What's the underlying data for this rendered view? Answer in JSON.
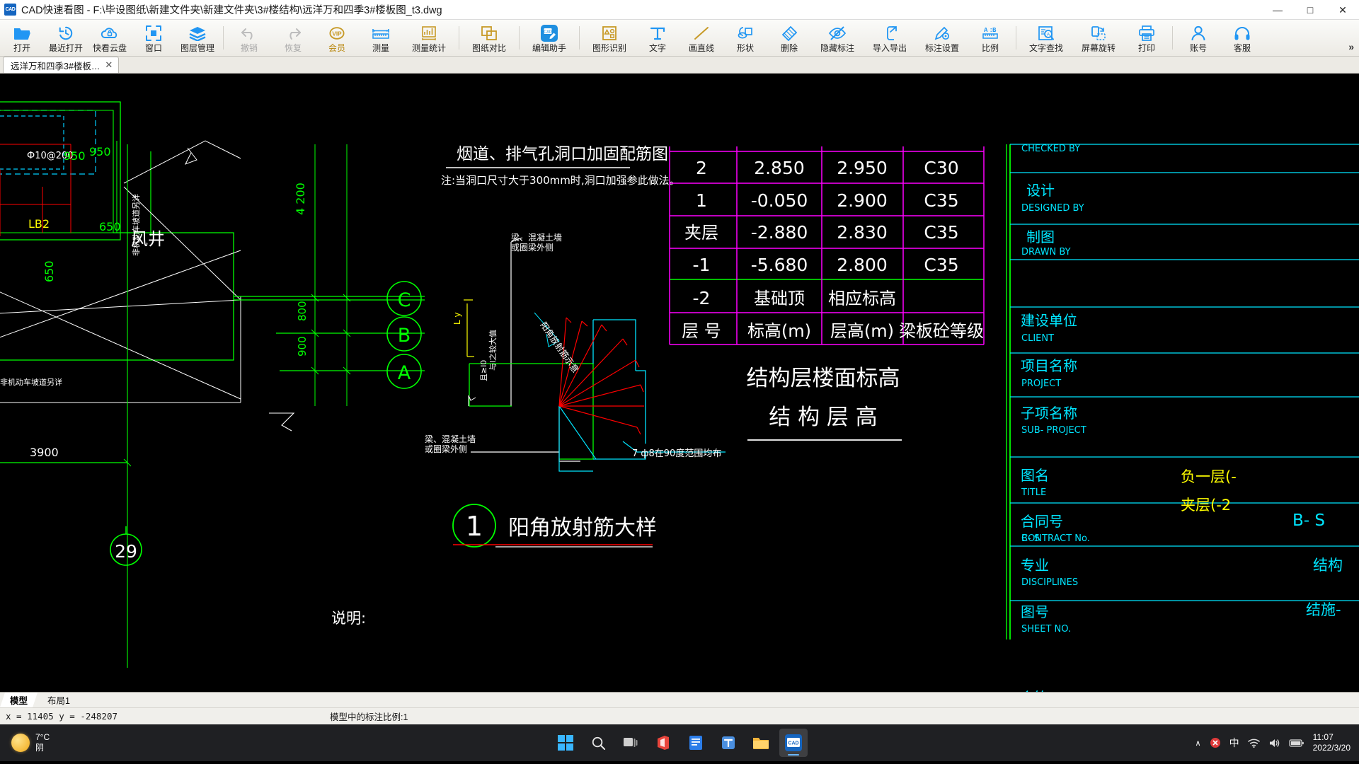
{
  "window": {
    "app_icon": "cad-app-icon",
    "title": "CAD快速看图 - F:\\毕设图纸\\新建文件夹\\新建文件夹\\3#楼结构\\远洋万和四季3#楼板图_t3.dwg",
    "minimize": "—",
    "maximize": "□",
    "close": "✕"
  },
  "toolbar": {
    "overflow": "»",
    "items": [
      {
        "label": "打开",
        "icon": "folder-open-icon",
        "state": "normal"
      },
      {
        "label": "最近打开",
        "icon": "recent-clock-icon",
        "state": "normal"
      },
      {
        "label": "快看云盘",
        "icon": "cloud-icon",
        "state": "normal"
      },
      {
        "label": "窗口",
        "icon": "window-frame-icon",
        "state": "normal"
      },
      {
        "label": "图层管理",
        "icon": "layers-icon",
        "state": "normal"
      },
      {
        "label": "撤销",
        "icon": "undo-arrow-icon",
        "state": "disabled"
      },
      {
        "label": "恢复",
        "icon": "redo-arrow-icon",
        "state": "disabled"
      },
      {
        "label": "会员",
        "icon": "vip-badge-icon",
        "state": "vip"
      },
      {
        "label": "测量",
        "icon": "ruler-icon",
        "state": "normal"
      },
      {
        "label": "测量统计",
        "icon": "measure-stats-icon",
        "state": "normal"
      },
      {
        "label": "图纸对比",
        "icon": "compare-drawings-icon",
        "state": "normal"
      },
      {
        "label": "编辑助手",
        "icon": "cad-edit-assistant-icon",
        "state": "normal"
      },
      {
        "label": "图形识别",
        "icon": "shape-recognition-icon",
        "state": "normal"
      },
      {
        "label": "文字",
        "icon": "text-tool-icon",
        "state": "normal"
      },
      {
        "label": "画直线",
        "icon": "line-tool-icon",
        "state": "normal"
      },
      {
        "label": "形状",
        "icon": "shapes-tool-icon",
        "state": "normal"
      },
      {
        "label": "删除",
        "icon": "eraser-icon",
        "state": "normal"
      },
      {
        "label": "隐藏标注",
        "icon": "hide-annotation-icon",
        "state": "normal"
      },
      {
        "label": "导入导出",
        "icon": "import-export-icon",
        "state": "normal"
      },
      {
        "label": "标注设置",
        "icon": "annotation-settings-icon",
        "state": "normal"
      },
      {
        "label": "比例",
        "icon": "scale-ratio-icon",
        "state": "normal"
      },
      {
        "label": "文字查找",
        "icon": "text-find-icon",
        "state": "normal"
      },
      {
        "label": "屏幕旋转",
        "icon": "screen-rotate-icon",
        "state": "normal"
      },
      {
        "label": "打印",
        "icon": "printer-icon",
        "state": "normal"
      },
      {
        "label": "账号",
        "icon": "account-person-icon",
        "state": "normal"
      },
      {
        "label": "客服",
        "icon": "headset-support-icon",
        "state": "normal"
      }
    ]
  },
  "file_tabs": [
    {
      "label": "远洋万和四季3#楼板…",
      "close": "✕",
      "active": true
    }
  ],
  "drawing": {
    "detail_title_1": "烟道、排气孔洞口加固配筋图",
    "detail_note_1": "注:当洞口尺寸大于300mm时,洞口加强参此做法。",
    "detail_number": "1",
    "detail_title_2": "阳角放射筋大样",
    "label_fengjing": "风井",
    "label_lb2": "LB2",
    "label_phi10": "Ф10@200",
    "dim_950": "950",
    "dim_950b": "950",
    "dim_650": "650",
    "dim_650b": "650",
    "dim_4200": "4 200",
    "dim_800": "800",
    "dim_900": "900",
    "dim_3900": "3900",
    "note_nonmotor_1": "非机动车坡道另详",
    "note_nonmotor_2": "非机动车坡道另详",
    "note_beam_wall_1": "梁、混凝土墙",
    "note_beam_wall_1b": "或圈梁外侧",
    "note_beam_wall_2": "梁、混凝土墙",
    "note_beam_wall_2b": "或圈梁外侧",
    "note_rebar_angle": "阳角放射筋示意",
    "note_lx": "L y",
    "note_ln": "与l之较大值",
    "note_ln2": "且≥l0",
    "note_radial": "7 ф8在90度范围均布",
    "note_shuoming": "说明:",
    "axis_labels": [
      "C",
      "B",
      "A"
    ],
    "gridmark_29": "29"
  },
  "elevation_table": {
    "headers": [
      "层 号",
      "标高(m)",
      "层高(m)",
      "梁板砼等级"
    ],
    "rows": [
      {
        "floor": "2",
        "elevation": "2.850",
        "height": "2.950",
        "grade": "C30"
      },
      {
        "floor": "1",
        "elevation": "-0.050",
        "height": "2.900",
        "grade": "C35"
      },
      {
        "floor": "夹层",
        "elevation": "-2.880",
        "height": "2.830",
        "grade": "C35"
      },
      {
        "floor": "-1",
        "elevation": "-5.680",
        "height": "2.800",
        "grade": "C35"
      },
      {
        "floor": "-2",
        "elevation": "基础顶",
        "height": "相应标高",
        "grade": ""
      }
    ],
    "caption_line1": "结构层楼面标高",
    "caption_line2": "结 构 层 高"
  },
  "title_block": {
    "rows": [
      {
        "cn": "设计",
        "en": "DESIGNED BY",
        "value": ""
      },
      {
        "cn": "制图",
        "en": "DRAWN  BY",
        "value": ""
      },
      {
        "cn": "",
        "en": "",
        "value": ""
      },
      {
        "cn": "建设单位",
        "en": "CLIENT",
        "value": ""
      },
      {
        "cn": "项目名称",
        "en": "PROJECT",
        "value": ""
      },
      {
        "cn": "子项名称",
        "en": "SUB- PROJECT",
        "value": ""
      },
      {
        "cn": "图名",
        "en": "TITLE",
        "value": "负一层(-",
        "value2": "夹层(-2"
      },
      {
        "cn": "合同号",
        "en": "CONTRACT No.",
        "value": "B- S"
      },
      {
        "cn": "专业",
        "en": "DISCIPLINES",
        "value": "结构"
      },
      {
        "cn": "图号",
        "en": "SHEET NO.",
        "value": "结施-"
      },
      {
        "cn": "会签",
        "en": "",
        "value": ""
      }
    ],
    "partial_top": "CHECKED BY"
  },
  "model_tabs": [
    {
      "label": "模型",
      "active": true
    },
    {
      "label": "布局1",
      "active": false
    }
  ],
  "statusbar": {
    "coords": "x = 11405  y = -248207",
    "scale": "模型中的标注比例:1"
  },
  "taskbar": {
    "weather_temp": "7°C",
    "weather_desc": "阴",
    "apps": [
      {
        "name": "start-windows-icon",
        "label": ""
      },
      {
        "name": "search-icon",
        "label": ""
      },
      {
        "name": "task-view-icon",
        "label": ""
      },
      {
        "name": "office-icon",
        "label": ""
      },
      {
        "name": "wps-writer-icon",
        "label": ""
      },
      {
        "name": "teams-icon",
        "label": ""
      },
      {
        "name": "file-explorer-icon",
        "label": ""
      },
      {
        "name": "cad-reader-icon",
        "label": "CAD"
      }
    ],
    "tray": {
      "chevron": "∧",
      "ime": "中",
      "time": "11:07",
      "date": "2022/3/20"
    }
  },
  "colors": {
    "accent": "#2196f3",
    "cad_green": "#00ff00",
    "cad_white": "#ffffff",
    "cad_magenta": "#ff00ff",
    "cad_cyan": "#00ffff",
    "cad_yellow": "#ffff00",
    "cad_red": "#ff0000",
    "vip_gold": "#c79a27",
    "canvas_bg": "#000000"
  }
}
